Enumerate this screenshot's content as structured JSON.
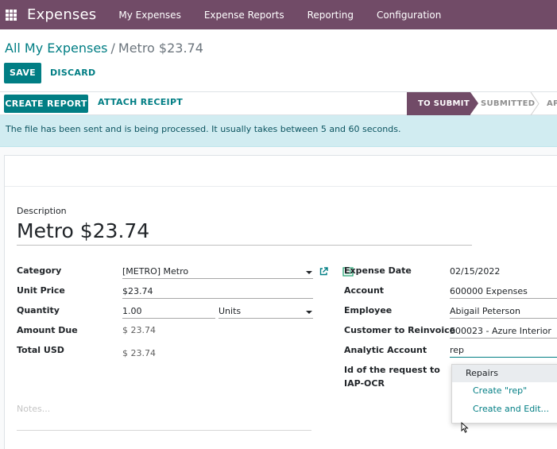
{
  "app": {
    "brand": "Expenses",
    "nav": [
      "My Expenses",
      "Expense Reports",
      "Reporting",
      "Configuration"
    ]
  },
  "breadcrumb": {
    "parent": "All My Expenses",
    "separator": "/",
    "current": "Metro $23.74"
  },
  "buttons": {
    "save": "SAVE",
    "discard": "DISCARD",
    "create_report": "CREATE REPORT",
    "attach_receipt": "ATTACH RECEIPT"
  },
  "status_stages": [
    {
      "label": "TO SUBMIT",
      "active": true
    },
    {
      "label": "SUBMITTED",
      "active": false
    },
    {
      "label": "AP",
      "active": false
    }
  ],
  "alert": "The file has been sent and is being processed. It usually takes between 5 and 60 seconds.",
  "form": {
    "description_label": "Description",
    "description_value": "Metro $23.74",
    "left": {
      "category_label": "Category",
      "category_value": "[METRO] Metro",
      "unit_price_label": "Unit Price",
      "unit_price_value": "$23.74",
      "quantity_label": "Quantity",
      "quantity_value": "1.00",
      "uom_value": "Units",
      "amount_due_label": "Amount Due",
      "amount_due_value": "$ 23.74",
      "total_label": "Total USD",
      "total_value": "$ 23.74"
    },
    "right": {
      "expense_date_label": "Expense Date",
      "expense_date_value": "02/15/2022",
      "account_label": "Account",
      "account_value": "600000 Expenses",
      "employee_label": "Employee",
      "employee_value": "Abigail Peterson",
      "customer_label": "Customer to Reinvoice",
      "customer_value": "S00023 - Azure Interior",
      "analytic_label": "Analytic Account",
      "analytic_value": "rep",
      "iap_label_line1": "Id of the request to",
      "iap_label_line2": "IAP-OCR"
    },
    "notes_placeholder": "Notes..."
  },
  "autocomplete": {
    "items": [
      "Repairs",
      "Create \"rep\"",
      "Create and Edit..."
    ]
  },
  "colors": {
    "brand": "#714B67",
    "primary": "#017e84",
    "alert_bg": "#d1ecf1"
  },
  "icons": [
    "apps-grid-icon",
    "external-link-icon",
    "attachment-icon",
    "dropdown-caret-icon",
    "mouse-cursor-icon"
  ]
}
